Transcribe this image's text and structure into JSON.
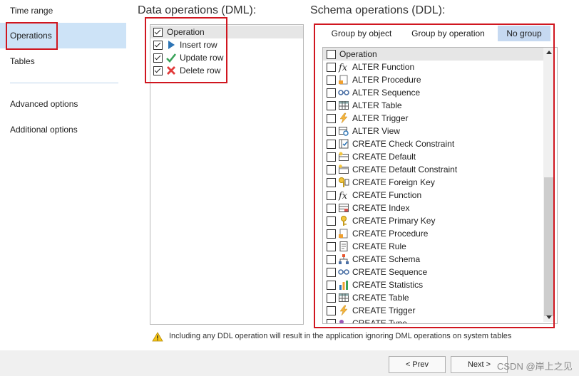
{
  "nav": {
    "time_range": "Time range",
    "operations": "Operations",
    "tables": "Tables",
    "advanced_options": "Advanced options",
    "additional_options": "Additional options"
  },
  "dml": {
    "title": "Data operations (DML):",
    "header": "Operation",
    "items": [
      {
        "label": "Insert row",
        "checked": true,
        "icon": "play-arrow-icon"
      },
      {
        "label": "Update row",
        "checked": true,
        "icon": "checkmark-icon"
      },
      {
        "label": "Delete row",
        "checked": true,
        "icon": "red-x-icon"
      }
    ]
  },
  "ddl": {
    "title": "Schema operations (DDL):",
    "tabs": [
      "Group by object",
      "Group by operation",
      "No group"
    ],
    "active_tab": "No group",
    "header": "Operation",
    "items": [
      {
        "label": "ALTER Function",
        "icon": "function-icon"
      },
      {
        "label": "ALTER Procedure",
        "icon": "procedure-icon"
      },
      {
        "label": "ALTER Sequence",
        "icon": "sequence-icon"
      },
      {
        "label": "ALTER Table",
        "icon": "table-icon"
      },
      {
        "label": "ALTER Trigger",
        "icon": "trigger-icon"
      },
      {
        "label": "ALTER View",
        "icon": "view-icon"
      },
      {
        "label": "CREATE Check Constraint",
        "icon": "check-constraint-icon"
      },
      {
        "label": "CREATE Default",
        "icon": "default-icon"
      },
      {
        "label": "CREATE Default Constraint",
        "icon": "default-constraint-icon"
      },
      {
        "label": "CREATE Foreign Key",
        "icon": "foreign-key-icon"
      },
      {
        "label": "CREATE Function",
        "icon": "function-icon"
      },
      {
        "label": "CREATE Index",
        "icon": "index-icon"
      },
      {
        "label": "CREATE Primary Key",
        "icon": "primary-key-icon"
      },
      {
        "label": "CREATE Procedure",
        "icon": "procedure-icon"
      },
      {
        "label": "CREATE Rule",
        "icon": "rule-icon"
      },
      {
        "label": "CREATE Schema",
        "icon": "schema-icon"
      },
      {
        "label": "CREATE Sequence",
        "icon": "sequence-icon"
      },
      {
        "label": "CREATE Statistics",
        "icon": "statistics-icon"
      },
      {
        "label": "CREATE Table",
        "icon": "table-icon"
      },
      {
        "label": "CREATE Trigger",
        "icon": "trigger-icon"
      },
      {
        "label": "CREATE Type",
        "icon": "type-icon"
      }
    ]
  },
  "warning": "Including any DDL operation will result in the application ignoring DML operations on system tables",
  "footer": {
    "prev": "< Prev",
    "next": "Next >",
    "watermark": "CSDN @岸上之见"
  }
}
